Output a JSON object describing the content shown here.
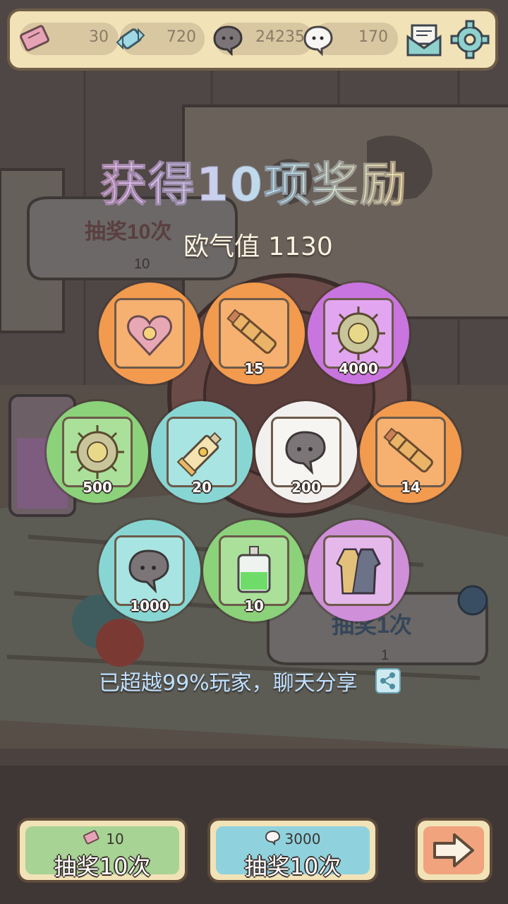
{
  "topbar": {
    "resources": [
      {
        "icon": "ticket-icon",
        "value": "30"
      },
      {
        "icon": "candy-icon",
        "value": "720"
      },
      {
        "icon": "dark-bubble-icon",
        "value": "24235"
      },
      {
        "icon": "white-bubble-icon",
        "value": "170"
      }
    ],
    "mail_icon": "mail-icon",
    "settings_icon": "gear-icon"
  },
  "background": {
    "sign_left_title": "抽奖10次",
    "sign_left_cost": "10",
    "sign_right_title": "抽奖1次",
    "sign_right_cost": "1"
  },
  "result": {
    "title": "获得10项奖励",
    "luck_label": "欧气值",
    "luck_value": "1130"
  },
  "rewards": [
    {
      "name": "heart-gem",
      "count": "",
      "color": "orange"
    },
    {
      "name": "telescope",
      "count": "15",
      "color": "orange"
    },
    {
      "name": "virus-coin",
      "count": "4000",
      "color": "purple"
    },
    {
      "name": "virus-coin",
      "count": "500",
      "color": "green"
    },
    {
      "name": "paint-tube",
      "count": "20",
      "color": "teal"
    },
    {
      "name": "dark-bubble",
      "count": "200",
      "color": "white"
    },
    {
      "name": "telescope",
      "count": "14",
      "color": "orange"
    },
    {
      "name": "dark-bubble",
      "count": "1000",
      "color": "teal"
    },
    {
      "name": "potion-bottle",
      "count": "10",
      "color": "green"
    },
    {
      "name": "coat",
      "count": "",
      "color": "lilac"
    }
  ],
  "share": {
    "text": "已超越99%玩家，聊天分享",
    "icon": "share-icon"
  },
  "buttons": {
    "draw_ticket": {
      "cost": "10",
      "label": "抽奖10次",
      "icon": "ticket-icon"
    },
    "draw_bubble": {
      "cost": "3000",
      "label": "抽奖10次",
      "icon": "bubble-icon"
    },
    "next": {
      "icon": "arrow-right-icon"
    }
  },
  "colors": {
    "orange": "#f29a4e",
    "purple": "#c975e0",
    "green": "#8bd27a",
    "teal": "#88d6d3",
    "white": "#f2f0ee",
    "lilac": "#cf8fd9"
  }
}
